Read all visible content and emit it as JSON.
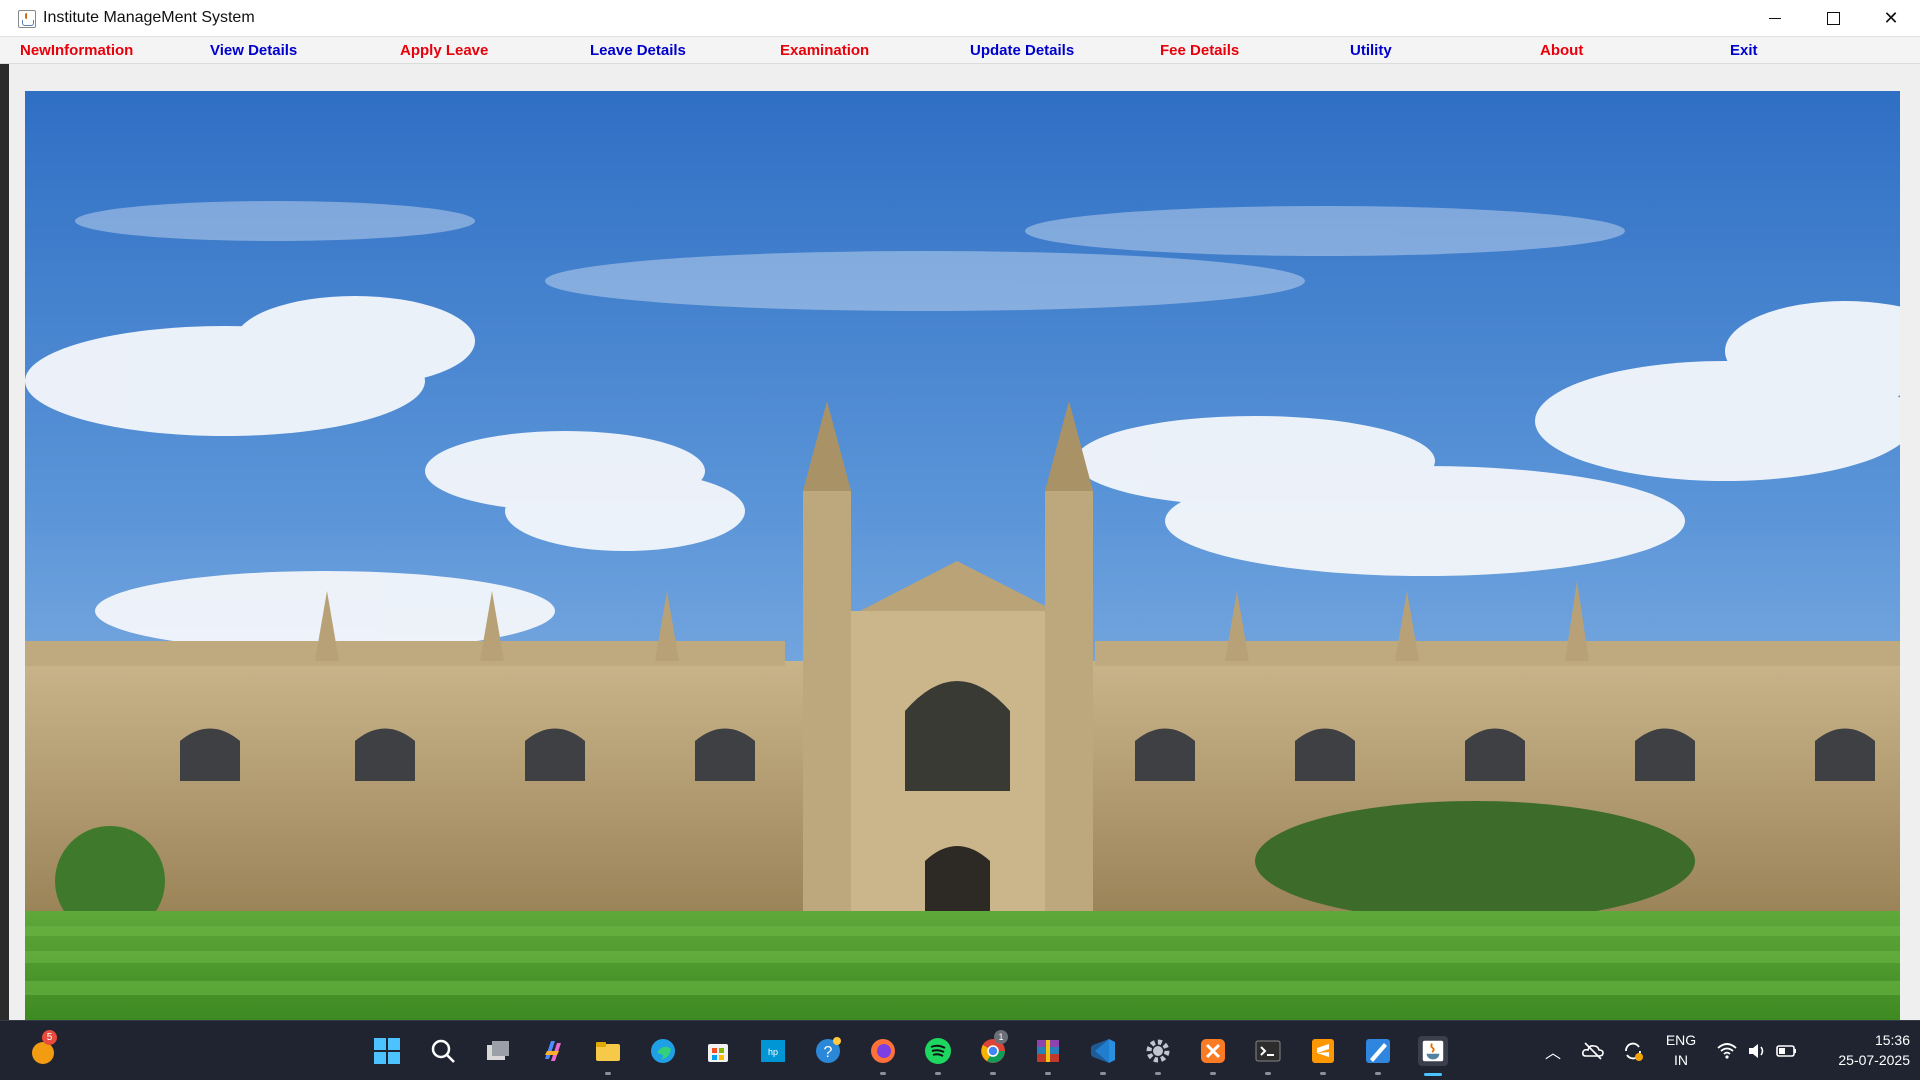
{
  "window": {
    "title": "Institute ManageMent System",
    "app_icon": "java-cup-icon",
    "controls": [
      "minimize-icon",
      "maximize-icon",
      "close-icon"
    ]
  },
  "menu": {
    "items": [
      {
        "label": "NewInformation",
        "color": "#e8000b"
      },
      {
        "label": "View Details",
        "color": "#0000cc"
      },
      {
        "label": "Apply Leave",
        "color": "#e8000b"
      },
      {
        "label": "Leave Details",
        "color": "#0000cc"
      },
      {
        "label": "Examination",
        "color": "#e8000b"
      },
      {
        "label": "Update Details",
        "color": "#0000cc"
      },
      {
        "label": "Fee Details",
        "color": "#e8000b"
      },
      {
        "label": "Utility",
        "color": "#0000cc"
      },
      {
        "label": "About",
        "color": "#e8000b"
      },
      {
        "label": "Exit",
        "color": "#0000cc"
      }
    ]
  },
  "background_image": "college-building-photo",
  "taskbar": {
    "notification_badge": "5",
    "chrome_badge": "1",
    "apps": [
      "weather-icon",
      "start-icon",
      "search-icon",
      "task-view-icon",
      "copilot-icon",
      "file-explorer-icon",
      "edge-icon",
      "store-icon",
      "myhp-icon",
      "help-icon",
      "firefox-icon",
      "spotify-icon",
      "chrome-icon",
      "winrar-icon",
      "vscode-icon",
      "settings-icon",
      "xampp-icon",
      "terminal-icon",
      "sublime-icon",
      "paint-icon",
      "java-icon"
    ],
    "tray": {
      "language_top": "ENG",
      "language_bottom": "IN",
      "time": "15:36",
      "date": "25-07-2025"
    }
  },
  "colors": {
    "menu_red": "#e8000b",
    "menu_blue": "#0000cc",
    "taskbar_bg": "#1f2430"
  }
}
